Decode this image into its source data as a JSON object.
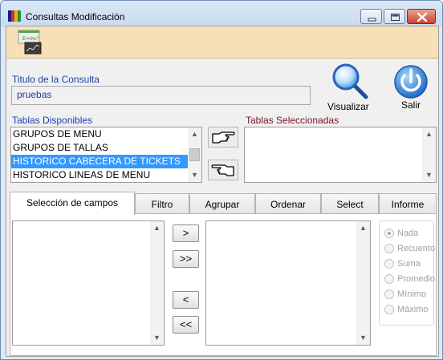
{
  "window": {
    "title": "Consultas Modificación",
    "minimize_icon": "minimize-icon",
    "maximize_icon": "maximize-icon",
    "close_icon": "close-icon"
  },
  "toolbar": {
    "icon": "query-chart-icon"
  },
  "form": {
    "titulo_label": "Titulo de la Consulta",
    "titulo_value": "pruebas",
    "visualizar_label": "Visualizar",
    "salir_label": "Salir"
  },
  "tablas_disponibles": {
    "label": "Tablas Disponibles",
    "items": [
      "GRUPOS DE MENU",
      "GRUPOS DE TALLAS",
      "HISTORICO CABECERA DE TICKETS",
      "HISTORICO LINEAS DE MENU"
    ],
    "selected_index": 2
  },
  "tablas_seleccionadas": {
    "label": "Tablas Seleccionadas",
    "items": []
  },
  "tabs": [
    "Selección de campos",
    "Filtro",
    "Agrupar",
    "Ordenar",
    "Select",
    "Informe"
  ],
  "active_tab": 0,
  "field_buttons": {
    "add": ">",
    "add_all": ">>",
    "remove": "<",
    "remove_all": "<<"
  },
  "aggregation": {
    "options": [
      "Nada",
      "Recuento",
      "Suma",
      "Promedio",
      "Mínimo",
      "Máximo"
    ],
    "selected_index": 0
  },
  "colors": {
    "label_blue": "#1c3fa8",
    "label_maroon": "#7a1020",
    "selection": "#3399ff",
    "toolbar_bg": "#f7dfb7"
  }
}
